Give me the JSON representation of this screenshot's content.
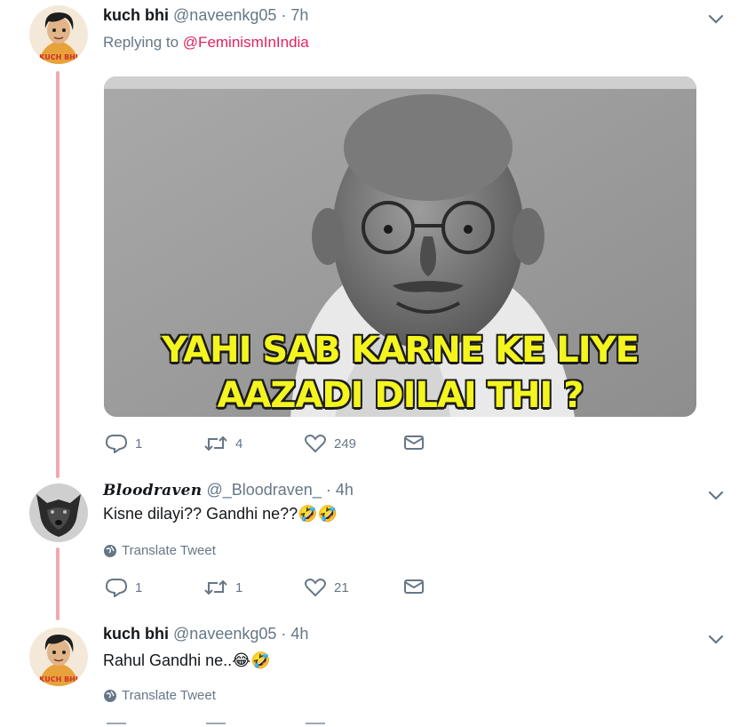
{
  "tweets": [
    {
      "display_name": "kuch bhi",
      "handle": "@naveenkg05",
      "separator": "·",
      "time": "7h",
      "replying_label": "Replying to",
      "replying_to": "@FeminismInIndia",
      "media": {
        "caption_line1": "YAHI SAB KARNE KE LIYE",
        "caption_line2": "AAZADI DILAI THI ?"
      },
      "stats": {
        "replies": "1",
        "retweets": "4",
        "likes": "249"
      }
    },
    {
      "display_name": "Bloodraven",
      "handle": "@_Bloodraven_",
      "separator": "·",
      "time": "4h",
      "text": "Kisne dilayi?? Gandhi ne??🤣🤣",
      "translate": "Translate Tweet",
      "stats": {
        "replies": "1",
        "retweets": "1",
        "likes": "21"
      }
    },
    {
      "display_name": "kuch bhi",
      "handle": "@naveenkg05",
      "separator": "·",
      "time": "4h",
      "text": "Rahul Gandhi ne..😂🤣",
      "translate": "Translate Tweet"
    }
  ],
  "avatar_badge": "KUCH BHI",
  "colors": {
    "thread_line": "#f0a9b3",
    "mention": "#e0245e",
    "muted": "#657786",
    "caption": "#f4f51f"
  },
  "icons": [
    "chevron-down-icon",
    "reply-icon",
    "retweet-icon",
    "like-icon",
    "dm-icon",
    "globe-icon"
  ]
}
